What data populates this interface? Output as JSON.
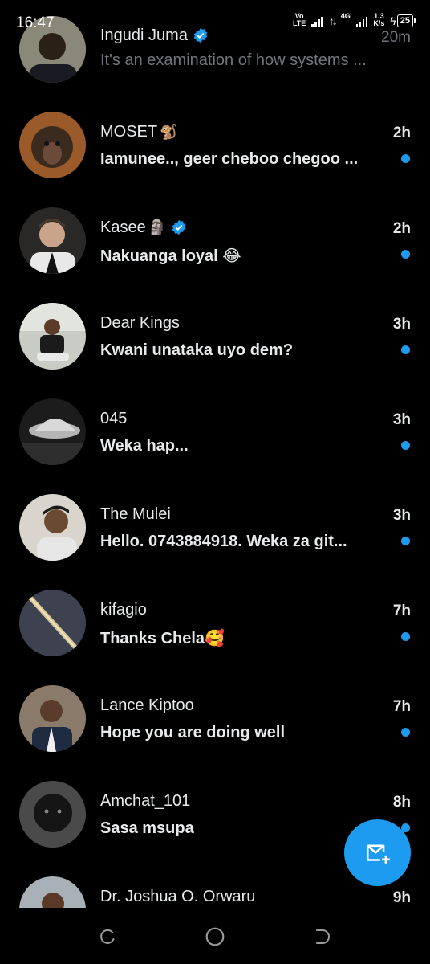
{
  "status_bar": {
    "time": "16:47",
    "volte_top": "Vo",
    "volte_bottom": "LTE",
    "network_type": "4G",
    "speed_value": "1.3",
    "speed_unit": "K/s",
    "battery": "25"
  },
  "accent_color": "#1d9bf0",
  "conversations": [
    {
      "name": "Ingudi Juma",
      "emoji": "",
      "verified": true,
      "time": "20m",
      "preview": "It's an examination of how systems ...",
      "unread": false
    },
    {
      "name": "MOSET",
      "emoji": "🐒",
      "verified": false,
      "time": "2h",
      "preview": "Iamunee.., geer cheboo chegoo ...",
      "unread": true
    },
    {
      "name": "Kasee",
      "emoji": "🗿",
      "verified": true,
      "time": "2h",
      "preview": "Nakuanga loyal 😂",
      "unread": true
    },
    {
      "name": "Dear Kings",
      "emoji": "",
      "verified": false,
      "time": "3h",
      "preview": "Kwani unataka uyo dem?",
      "unread": true
    },
    {
      "name": "045",
      "emoji": "",
      "verified": false,
      "time": "3h",
      "preview": "Weka hap...",
      "unread": true
    },
    {
      "name": "The Mulei",
      "emoji": "",
      "verified": false,
      "time": "3h",
      "preview": "Hello. 0743884918. Weka za git...",
      "unread": true
    },
    {
      "name": "kifagio",
      "emoji": "",
      "verified": false,
      "time": "7h",
      "preview": "Thanks Chela🥰",
      "unread": true
    },
    {
      "name": "Lance Kiptoo",
      "emoji": "",
      "verified": false,
      "time": "7h",
      "preview": "Hope you are doing well",
      "unread": true
    },
    {
      "name": "Amchat_101",
      "emoji": "",
      "verified": false,
      "time": "8h",
      "preview": "Sasa msupa",
      "unread": true
    },
    {
      "name": "Dr. Joshua O. Orwaru",
      "emoji": "",
      "verified": false,
      "time": "9h",
      "preview": "",
      "unread": false
    }
  ],
  "fab": {
    "icon": "new-message-icon"
  },
  "nav": {
    "icons": [
      "recent-apps-icon",
      "home-icon",
      "back-icon"
    ]
  }
}
